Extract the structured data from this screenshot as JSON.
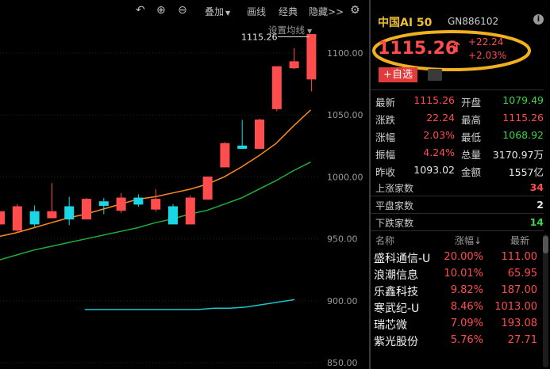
{
  "toolbar": {
    "undo_icon": "undo-icon",
    "zoom_in_icon": "zoom-in-icon",
    "zoom_out_icon": "zoom-out-icon",
    "overlay_label": "叠加",
    "draw_label": "画线",
    "classic_label": "经典",
    "hide_label": "隐藏>>",
    "settings_icon": "gear-icon",
    "ma_setting_label": "设置均线"
  },
  "chart_data": {
    "type": "candlestick",
    "y_ticks": [
      "1100.00",
      "1050.00",
      "1000.00",
      "950.00",
      "900.00",
      "850.00"
    ],
    "ylim": [
      845,
      1130
    ],
    "last_price_label": "1115.26",
    "candles": [
      {
        "o": 962,
        "c": 972,
        "h": 972,
        "l": 962,
        "dir": "up"
      },
      {
        "o": 976,
        "c": 957,
        "h": 978,
        "l": 955,
        "dir": "up"
      },
      {
        "o": 962,
        "c": 972,
        "h": 977,
        "l": 960,
        "dir": "down"
      },
      {
        "o": 967,
        "c": 972,
        "h": 995,
        "l": 967,
        "dir": "up"
      },
      {
        "o": 966,
        "c": 976,
        "h": 984,
        "l": 961,
        "dir": "down"
      },
      {
        "o": 966,
        "c": 982,
        "h": 983,
        "l": 966,
        "dir": "up"
      },
      {
        "o": 977,
        "c": 980,
        "h": 983,
        "l": 970,
        "dir": "down"
      },
      {
        "o": 973,
        "c": 983,
        "h": 987,
        "l": 971,
        "dir": "up"
      },
      {
        "o": 978,
        "c": 983,
        "h": 986,
        "l": 976,
        "dir": "down"
      },
      {
        "o": 974,
        "c": 982,
        "h": 990,
        "l": 972,
        "dir": "up"
      },
      {
        "o": 976,
        "c": 962,
        "h": 978,
        "l": 962,
        "dir": "down"
      },
      {
        "o": 962,
        "c": 983,
        "h": 985,
        "l": 962,
        "dir": "up"
      },
      {
        "o": 982,
        "c": 1000,
        "h": 1000,
        "l": 982,
        "dir": "up"
      },
      {
        "o": 1008,
        "c": 1027,
        "h": 1028,
        "l": 1008,
        "dir": "up"
      },
      {
        "o": 1023,
        "c": 1025,
        "h": 1046,
        "l": 1023,
        "dir": "down"
      },
      {
        "o": 1023,
        "c": 1046,
        "h": 1047,
        "l": 1023,
        "dir": "up"
      },
      {
        "o": 1055,
        "c": 1089,
        "h": 1089,
        "l": 1053,
        "dir": "up"
      },
      {
        "o": 1088,
        "c": 1093,
        "h": 1104,
        "l": 1087,
        "dir": "up"
      },
      {
        "o": 1079,
        "c": 1115,
        "h": 1115,
        "l": 1069,
        "dir": "up"
      }
    ],
    "ma_orange": [
      952,
      955,
      959,
      963,
      967,
      970,
      974,
      978,
      982,
      984,
      987,
      990,
      994,
      1000,
      1008,
      1017,
      1027,
      1041,
      1054
    ],
    "ma_green": [
      933,
      937,
      941,
      944,
      947,
      950,
      953,
      956,
      959,
      963,
      966,
      970,
      973,
      978,
      983,
      990,
      997,
      1005,
      1012
    ],
    "ma_cyan": [
      893,
      893,
      893,
      893,
      893,
      893,
      893,
      893,
      894,
      894,
      895,
      897,
      899,
      901
    ]
  },
  "panel": {
    "name": "中国AI 50",
    "code": "GN886102",
    "info_icon": "info-icon",
    "price": "1115.26",
    "arrow": "↑",
    "change": "+22.24",
    "change_pct": "+2.03%",
    "add_watch": "+自选",
    "extra_icon": "chart-icon",
    "stats": [
      {
        "l1": "最新",
        "v1": "1115.26",
        "c1": "red",
        "l2": "开盘",
        "v2": "1079.49",
        "c2": "green"
      },
      {
        "l1": "涨跌",
        "v1": "22.24",
        "c1": "red",
        "l2": "最高",
        "v2": "1115.26",
        "c2": "red"
      },
      {
        "l1": "涨幅",
        "v1": "2.03%",
        "c1": "red",
        "l2": "最低",
        "v2": "1068.92",
        "c2": "green"
      },
      {
        "l1": "振幅",
        "v1": "4.24%",
        "c1": "red",
        "l2": "总量",
        "v2": "3170.97万",
        "c2": "white"
      },
      {
        "l1": "昨收",
        "v1": "1093.02",
        "c1": "white",
        "l2": "金额",
        "v2": "1557亿",
        "c2": "white"
      }
    ],
    "breadth": [
      {
        "label": "上涨家数",
        "value": "34",
        "color": "red"
      },
      {
        "label": "平盘家数",
        "value": "2",
        "color": "white"
      },
      {
        "label": "下跌家数",
        "value": "14",
        "color": "green"
      }
    ],
    "list_header": {
      "name": "名称",
      "pct": "涨幅↓",
      "latest": "最新"
    },
    "stocks": [
      {
        "name": "盛科通信-U",
        "pct": "20.00%",
        "price": "111.00"
      },
      {
        "name": "浪潮信息",
        "pct": "10.01%",
        "price": "65.95"
      },
      {
        "name": "乐鑫科技",
        "pct": "9.82%",
        "price": "187.00"
      },
      {
        "name": "寒武纪-U",
        "pct": "8.46%",
        "price": "1013.00"
      },
      {
        "name": "瑞芯微",
        "pct": "7.09%",
        "price": "193.08"
      },
      {
        "name": "紫光股份",
        "pct": "5.76%",
        "price": "27.71"
      }
    ],
    "colors": {
      "up": "#ff4d4d",
      "down": "#3fd24a",
      "hollow": "#18d8e6",
      "ma_orange": "#ff8a1e",
      "ma_green": "#1fae3c",
      "ma_cyan": "#18c6c6",
      "highlight": "#f0b020"
    }
  }
}
